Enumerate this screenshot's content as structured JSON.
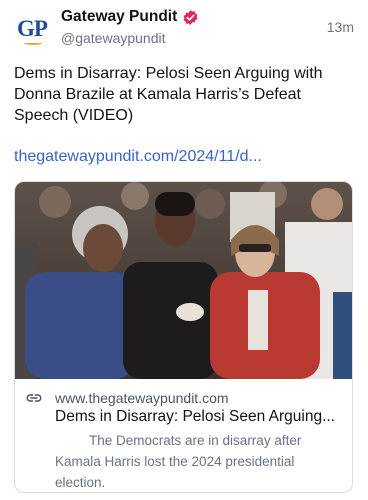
{
  "post": {
    "author_name": "Gateway Pundit",
    "author_handle": "@gatewaypundit",
    "avatar_text": "GP",
    "timestamp": "13m",
    "text": "Dems in Disarray: Pelosi Seen Arguing with Donna Brazile at Kamala Harris’s Defeat Speech (VIDEO)",
    "link_text": "thegatewaypundit.com/2024/11/d..."
  },
  "card": {
    "domain": "www.thegatewaypundit.com",
    "title": "Dems in Disarray: Pelosi Seen Arguing...",
    "description": "The Democrats are in disarray after Kamala Harris lost the 2024 presidential election."
  },
  "icons": {
    "verified": "verified-badge-icon",
    "link": "link-chain-icon"
  },
  "colors": {
    "verified_badge": "#e0245e",
    "link": "#3b63c4",
    "avatar_text": "#1d4e9e",
    "avatar_accent": "#e8a33d"
  }
}
